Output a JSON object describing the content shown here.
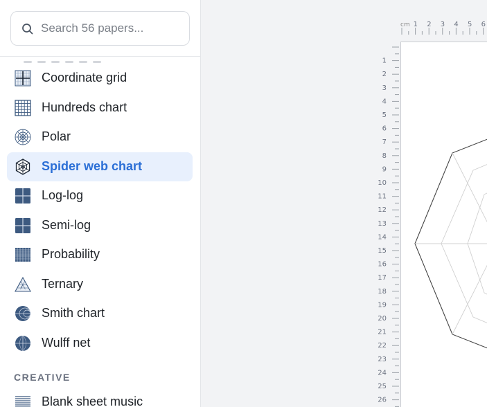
{
  "search": {
    "placeholder": "Search 56 papers..."
  },
  "papers": [
    {
      "label": "Coordinate grid",
      "icon": "coordinate-grid-icon",
      "active": false
    },
    {
      "label": "Hundreds chart",
      "icon": "hundreds-chart-icon",
      "active": false
    },
    {
      "label": "Polar",
      "icon": "polar-icon",
      "active": false
    },
    {
      "label": "Spider web chart",
      "icon": "spider-web-icon",
      "active": true
    },
    {
      "label": "Log-log",
      "icon": "log-log-icon",
      "active": false
    },
    {
      "label": "Semi-log",
      "icon": "semi-log-icon",
      "active": false
    },
    {
      "label": "Probability",
      "icon": "probability-icon",
      "active": false
    },
    {
      "label": "Ternary",
      "icon": "ternary-icon",
      "active": false
    },
    {
      "label": "Smith chart",
      "icon": "smith-chart-icon",
      "active": false
    },
    {
      "label": "Wulff net",
      "icon": "wulff-net-icon",
      "active": false
    }
  ],
  "section": {
    "title": "CREATIVE"
  },
  "creative": [
    {
      "label": "Blank sheet music",
      "icon": "sheet-music-icon"
    }
  ],
  "ruler": {
    "unit": "cm",
    "top_ticks": [
      "1",
      "2",
      "3",
      "4",
      "5",
      "6"
    ],
    "left_ticks": [
      "1",
      "2",
      "3",
      "4",
      "5",
      "6",
      "7",
      "8",
      "9",
      "10",
      "11",
      "12",
      "13",
      "14",
      "15",
      "16",
      "17",
      "18",
      "19",
      "20",
      "21",
      "22",
      "23",
      "24",
      "25",
      "26"
    ]
  },
  "colors": {
    "accent": "#2b6fd6",
    "active_bg": "#e8f0fd",
    "icon_fill": "#3d5a80"
  }
}
